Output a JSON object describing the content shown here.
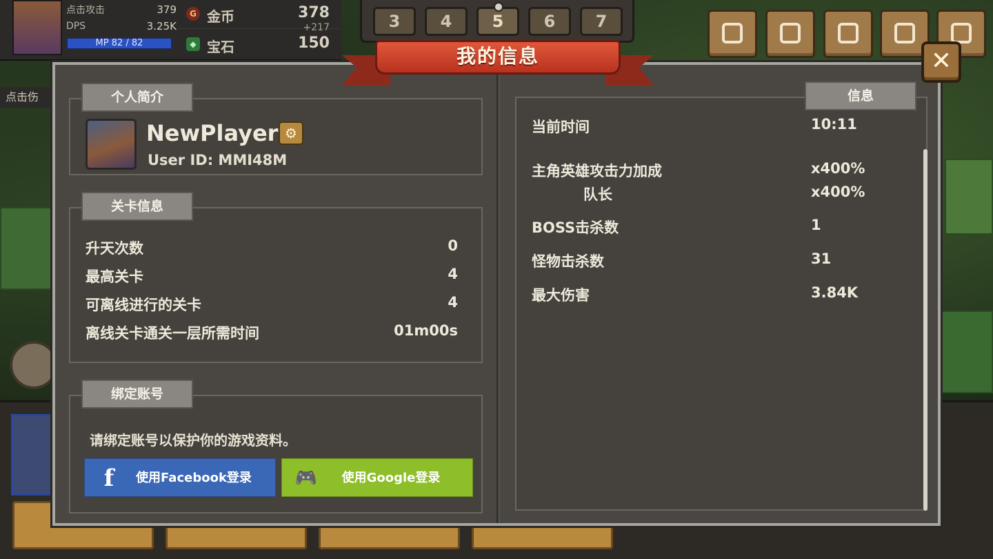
{
  "hud": {
    "tap_attack_label": "点击攻击",
    "tap_attack_value": "379",
    "dps_label": "DPS",
    "dps_value": "3.25K",
    "mp_text": "MP 82 / 82",
    "gold_label": "金币",
    "gold_value": "378",
    "gold_delta": "+217",
    "gem_label": "宝石",
    "gem_value": "150",
    "side_tag": "点击伤"
  },
  "stages": [
    "3",
    "4",
    "5",
    "6",
    "7"
  ],
  "current_stage": "5",
  "menu_icons": [
    "gamepad-icon",
    "camp-icon",
    "trophy-icon",
    "shop-icon",
    "grid-icon"
  ],
  "modal": {
    "title": "我的信息",
    "close_label": "✕",
    "profile": {
      "section_title": "个人简介",
      "player_name": "NewPlayer",
      "user_id": "User ID: MMI48M",
      "settings_icon": "gear-icon"
    },
    "stage_info": {
      "section_title": "关卡信息",
      "rows": [
        {
          "label": "升天次数",
          "value": "0"
        },
        {
          "label": "最高关卡",
          "value": "4"
        },
        {
          "label": "可离线进行的关卡",
          "value": "4"
        },
        {
          "label": "离线关卡通关一层所需时间",
          "value": "01m00s"
        }
      ]
    },
    "bind_account": {
      "section_title": "绑定账号",
      "prompt": "请绑定账号以保护你的游戏资料。",
      "facebook_label": "使用Facebook登录",
      "google_label": "使用Google登录"
    },
    "info": {
      "section_title": "信息",
      "rows": [
        {
          "label": "当前时间",
          "value": "10:11"
        },
        {
          "label": "主角英雄攻击力加成",
          "value": "x400%"
        },
        {
          "label": "队长",
          "value": "x400%"
        },
        {
          "label": "BOSS击杀数",
          "value": "1"
        },
        {
          "label": "怪物击杀数",
          "value": "31"
        },
        {
          "label": "最大伤害",
          "value": "3.84K"
        }
      ]
    }
  },
  "colors": {
    "facebook": "#3b68b6",
    "google": "#8ebe2a",
    "ribbon": "#c63c25",
    "panel": "#4a4742",
    "section_title_bg": "#8a8782"
  }
}
